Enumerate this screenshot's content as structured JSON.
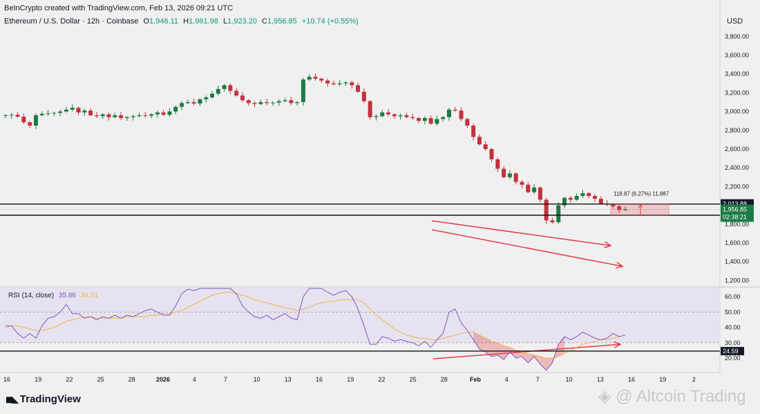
{
  "header": {
    "creator": "BeInCrypto created with TradingView.com, Feb 13, 2026 09:21 UTC",
    "symbol": "Ethereum / U.S. Dollar · 12h · Coinbase",
    "ohlc": {
      "open_label": "O",
      "open": "1,946.11",
      "high_label": "H",
      "high": "1,961.98",
      "low_label": "L",
      "low": "1,923.20",
      "close_label": "C",
      "close": "1,956.85",
      "change": "+10.74 (+0.55%)"
    }
  },
  "currency": "USD",
  "rsi_legend": {
    "label": "RSI (14, close)",
    "rsi": "35.86",
    "ma": "34.61"
  },
  "brand": {
    "logo_text": "TradingView"
  },
  "watermark": "Altcoin Trading",
  "chart_data": [
    {
      "type": "candlestick",
      "title": "Ethereum / U.S. Dollar · 12h · Coinbase",
      "ylim": [
        1100,
        3950
      ],
      "y_ticks": [
        "1,200.00",
        "1,400.00",
        "1,600.00",
        "1,800.00",
        "2,000.00",
        "2,200.00",
        "2,400.00",
        "2,600.00",
        "2,800.00",
        "3,000.00",
        "3,200.00",
        "3,400.00",
        "3,600.00",
        "3,800.00"
      ],
      "x_ticks": [
        "16",
        "19",
        "22",
        "25",
        "28",
        "2026",
        "4",
        "7",
        "10",
        "13",
        "16",
        "19",
        "22",
        "25",
        "28",
        "Feb",
        "4",
        "7",
        "10",
        "13",
        "16",
        "19",
        "2"
      ],
      "close": [
        2960,
        2965,
        2945,
        2885,
        2850,
        2960,
        2975,
        2980,
        2985,
        3000,
        3020,
        3040,
        2990,
        3010,
        2960,
        2950,
        2970,
        2940,
        2960,
        2930,
        2940,
        2950,
        2960,
        2955,
        2970,
        2990,
        2965,
        3000,
        3050,
        3090,
        3100,
        3085,
        3130,
        3150,
        3190,
        3240,
        3280,
        3220,
        3170,
        3120,
        3090,
        3080,
        3100,
        3090,
        3095,
        3110,
        3120,
        3090,
        3100,
        3340,
        3370,
        3350,
        3330,
        3300,
        3290,
        3300,
        3310,
        3280,
        3210,
        3110,
        2940,
        2950,
        2990,
        2970,
        2950,
        2960,
        2940,
        2930,
        2900,
        2930,
        2870,
        2920,
        2940,
        3020,
        3010,
        2920,
        2850,
        2730,
        2650,
        2600,
        2490,
        2390,
        2300,
        2340,
        2250,
        2220,
        2140,
        2190,
        2060,
        1840,
        1820,
        2000,
        2080,
        2060,
        2100,
        2130,
        2100,
        2070,
        2020,
        2010,
        1990,
        1950,
        1960
      ],
      "price_levels": [
        {
          "label": "2,013.88",
          "value": 2013.88
        },
        {
          "label": "1,895.01",
          "value": 1895.01
        }
      ],
      "last_price": {
        "label": "1,956.85",
        "value": 1956.85,
        "countdown": "02:38:21"
      },
      "projection": {
        "text": "118.87 (6.27%) 11,887"
      }
    },
    {
      "type": "line",
      "title": "RSI (14, close)",
      "ylim": [
        12,
        66
      ],
      "y_ticks": [
        "20.00",
        "30.00",
        "40.00",
        "50.00",
        "60.00"
      ],
      "series": [
        {
          "name": "RSI",
          "color": "#7e57c2",
          "values": [
            41,
            41,
            36,
            33,
            36,
            33,
            41,
            46,
            47,
            50,
            55,
            49,
            49,
            46,
            47,
            45,
            47,
            46,
            48,
            46,
            48,
            47,
            49,
            51,
            52,
            50,
            48,
            48,
            54,
            62,
            65,
            64,
            67,
            68,
            70,
            72,
            76,
            69,
            62,
            54,
            50,
            47,
            46,
            48,
            45,
            47,
            49,
            46,
            45,
            60,
            72,
            70,
            67,
            63,
            61,
            63,
            64,
            60,
            52,
            41,
            29,
            29,
            34,
            33,
            31,
            32,
            31,
            30,
            28,
            31,
            27,
            32,
            36,
            50,
            52,
            43,
            38,
            32,
            26,
            24,
            21,
            22,
            19,
            24,
            20,
            21,
            17,
            21,
            16,
            12,
            17,
            29,
            34,
            32,
            34,
            37,
            35,
            33,
            32,
            33,
            36,
            34,
            35
          ]
        },
        {
          "name": "MA",
          "color": "#f2b63c",
          "values": [
            40,
            41,
            41,
            40,
            39,
            38,
            38,
            39,
            40,
            42,
            44,
            45,
            46,
            47,
            47,
            46,
            46,
            46,
            46,
            46,
            47,
            47,
            47,
            47,
            48,
            48,
            49,
            49,
            50,
            51,
            53,
            55,
            57,
            59,
            61,
            62,
            63,
            63,
            62,
            61,
            60,
            58,
            57,
            56,
            55,
            54,
            53,
            52,
            51,
            52,
            53,
            55,
            56,
            57,
            57,
            58,
            58,
            58,
            58,
            56,
            52,
            48,
            45,
            42,
            39,
            37,
            35,
            34,
            33,
            33,
            32,
            32,
            33,
            34,
            35,
            36,
            37,
            37,
            35,
            33,
            31,
            30,
            28,
            27,
            25,
            24,
            23,
            22,
            21,
            20,
            20,
            21,
            23,
            25,
            27,
            29,
            30,
            31,
            32,
            32,
            33,
            34,
            35
          ]
        }
      ],
      "levels": [
        {
          "label": "24.59",
          "value": 24.59
        }
      ],
      "band": [
        30,
        70
      ]
    }
  ],
  "colors": {
    "up": "#1c7a46",
    "down": "#c4313d",
    "rsi": "#7e57c2",
    "rsi_ma": "#f2b63c",
    "annotation": "#e23c44",
    "bg": "#f0f0f0",
    "band": "#e6e2f0"
  }
}
